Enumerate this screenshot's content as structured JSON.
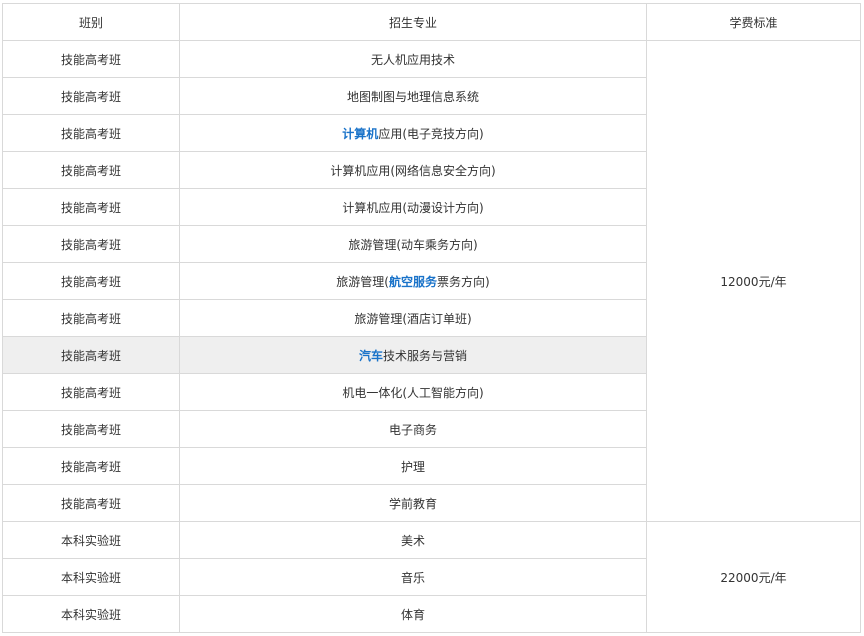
{
  "headers": {
    "class": "班别",
    "major": "招生专业",
    "fee": "学费标准"
  },
  "rows": [
    {
      "class": "技能高考班",
      "major_pre": "",
      "major_link": "",
      "major_post": "无人机应用技术"
    },
    {
      "class": "技能高考班",
      "major_pre": "",
      "major_link": "",
      "major_post": "地图制图与地理信息系统"
    },
    {
      "class": "技能高考班",
      "major_pre": "",
      "major_link": "计算机",
      "major_post": "应用(电子竞技方向)"
    },
    {
      "class": "技能高考班",
      "major_pre": "",
      "major_link": "",
      "major_post": "计算机应用(网络信息安全方向)"
    },
    {
      "class": "技能高考班",
      "major_pre": "",
      "major_link": "",
      "major_post": "计算机应用(动漫设计方向)"
    },
    {
      "class": "技能高考班",
      "major_pre": "",
      "major_link": "",
      "major_post": "旅游管理(动车乘务方向)"
    },
    {
      "class": "技能高考班",
      "major_pre": "旅游管理(",
      "major_link": "航空服务",
      "major_post": "票务方向)"
    },
    {
      "class": "技能高考班",
      "major_pre": "",
      "major_link": "",
      "major_post": "旅游管理(酒店订单班)"
    },
    {
      "class": "技能高考班",
      "major_pre": "",
      "major_link": "汽车",
      "major_post": "技术服务与营销"
    },
    {
      "class": "技能高考班",
      "major_pre": "",
      "major_link": "",
      "major_post": "机电一体化(人工智能方向)"
    },
    {
      "class": "技能高考班",
      "major_pre": "",
      "major_link": "",
      "major_post": "电子商务"
    },
    {
      "class": "技能高考班",
      "major_pre": "",
      "major_link": "",
      "major_post": "护理"
    },
    {
      "class": "技能高考班",
      "major_pre": "",
      "major_link": "",
      "major_post": "学前教育"
    },
    {
      "class": "本科实验班",
      "major_pre": "",
      "major_link": "",
      "major_post": "美术"
    },
    {
      "class": "本科实验班",
      "major_pre": "",
      "major_link": "",
      "major_post": "音乐"
    },
    {
      "class": "本科实验班",
      "major_pre": "",
      "major_link": "",
      "major_post": "体育"
    }
  ],
  "fees": {
    "skill_class": "12000元/年",
    "undergrad_class": "22000元/年"
  },
  "colors": {
    "link": "#1a73c9",
    "border": "#d9d9d9",
    "highlight_row": "#efefef",
    "text": "#333333"
  }
}
